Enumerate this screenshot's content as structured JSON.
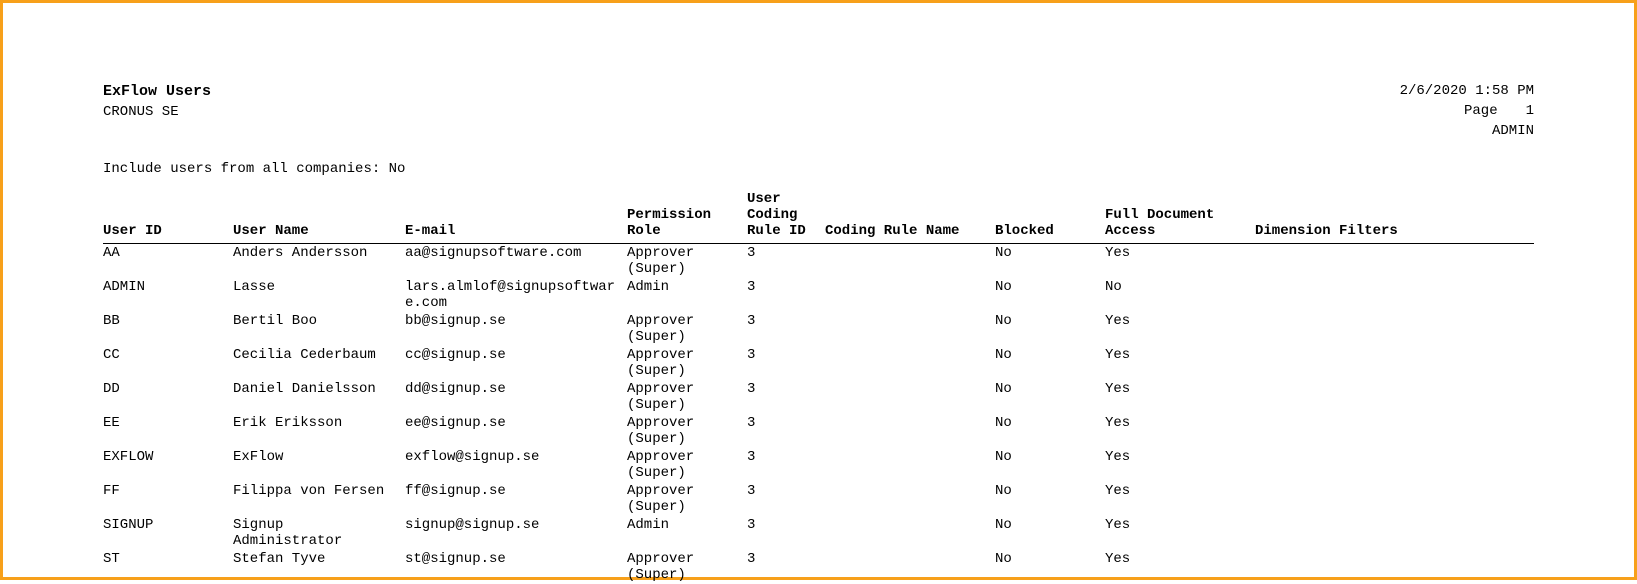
{
  "header": {
    "title": "ExFlow Users",
    "company": "CRONUS SE",
    "timestamp": "2/6/2020 1:58 PM",
    "page_label": "Page",
    "page_number": "1",
    "username": "ADMIN"
  },
  "filter": {
    "label": "Include users from all companies:",
    "value": "No"
  },
  "columns": {
    "user_id": "User ID",
    "user_name": "User Name",
    "email": "E-mail",
    "permission_role": "Permission Role",
    "user_coding_rule_id": "User Coding Rule ID",
    "coding_rule_name": "Coding Rule Name",
    "blocked": "Blocked",
    "full_document_access": "Full Document Access",
    "dimension_filters": "Dimension Filters"
  },
  "rows": [
    {
      "user_id": "AA",
      "user_name": "Anders Andersson",
      "email": "aa@signupsoftware.com",
      "permission_role": "Approver (Super)",
      "rule_id": "3",
      "rule_name": "",
      "blocked": "No",
      "full_doc": "Yes",
      "dim": ""
    },
    {
      "user_id": "ADMIN",
      "user_name": "Lasse",
      "email": "lars.almlof@signupsoftware.com",
      "permission_role": "Admin",
      "rule_id": "3",
      "rule_name": "",
      "blocked": "No",
      "full_doc": "No",
      "dim": ""
    },
    {
      "user_id": "BB",
      "user_name": "Bertil Boo",
      "email": "bb@signup.se",
      "permission_role": "Approver (Super)",
      "rule_id": "3",
      "rule_name": "",
      "blocked": "No",
      "full_doc": "Yes",
      "dim": ""
    },
    {
      "user_id": "CC",
      "user_name": "Cecilia Cederbaum",
      "email": "cc@signup.se",
      "permission_role": "Approver (Super)",
      "rule_id": "3",
      "rule_name": "",
      "blocked": "No",
      "full_doc": "Yes",
      "dim": ""
    },
    {
      "user_id": "DD",
      "user_name": "Daniel Danielsson",
      "email": "dd@signup.se",
      "permission_role": "Approver (Super)",
      "rule_id": "3",
      "rule_name": "",
      "blocked": "No",
      "full_doc": "Yes",
      "dim": ""
    },
    {
      "user_id": "EE",
      "user_name": "Erik Eriksson",
      "email": "ee@signup.se",
      "permission_role": "Approver (Super)",
      "rule_id": "3",
      "rule_name": "",
      "blocked": "No",
      "full_doc": "Yes",
      "dim": ""
    },
    {
      "user_id": "EXFLOW",
      "user_name": "ExFlow",
      "email": "exflow@signup.se",
      "permission_role": "Approver (Super)",
      "rule_id": "3",
      "rule_name": "",
      "blocked": "No",
      "full_doc": "Yes",
      "dim": ""
    },
    {
      "user_id": "FF",
      "user_name": "Filippa von Fersen",
      "email": "ff@signup.se",
      "permission_role": "Approver (Super)",
      "rule_id": "3",
      "rule_name": "",
      "blocked": "No",
      "full_doc": "Yes",
      "dim": ""
    },
    {
      "user_id": "SIGNUP",
      "user_name": "Signup Administrator",
      "email": "signup@signup.se",
      "permission_role": "Admin",
      "rule_id": "3",
      "rule_name": "",
      "blocked": "No",
      "full_doc": "Yes",
      "dim": ""
    },
    {
      "user_id": "ST",
      "user_name": "Stefan Tyve",
      "email": "st@signup.se",
      "permission_role": "Approver (Super)",
      "rule_id": "3",
      "rule_name": "",
      "blocked": "No",
      "full_doc": "Yes",
      "dim": ""
    }
  ]
}
